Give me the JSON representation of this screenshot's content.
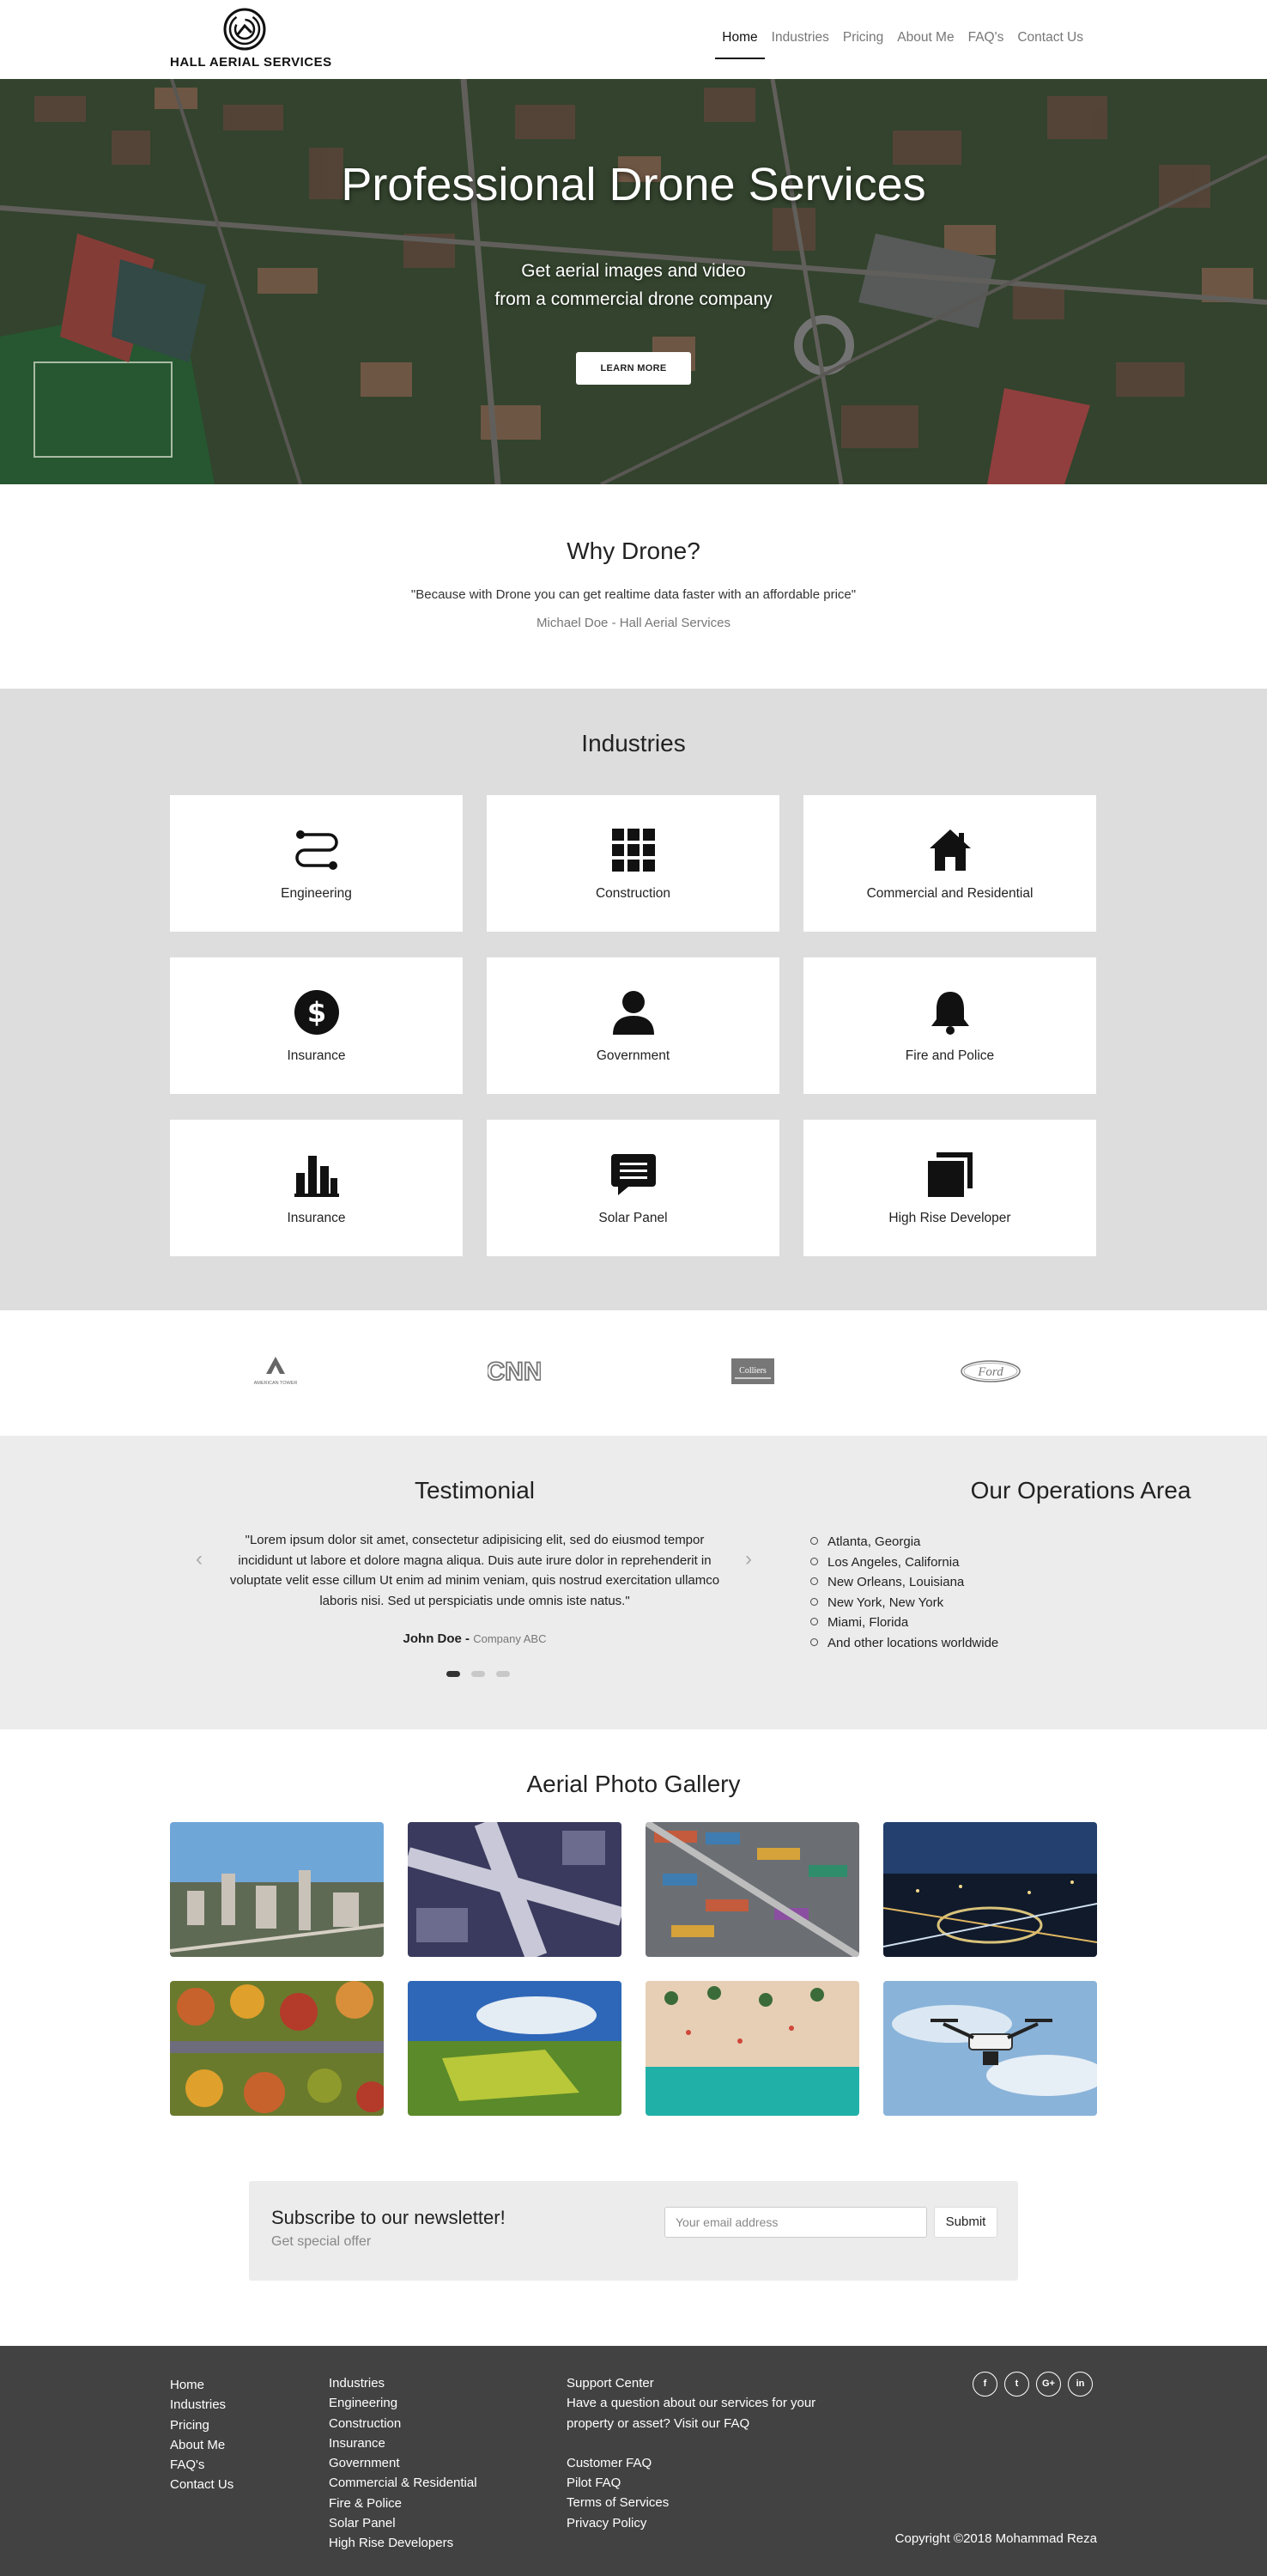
{
  "brand": {
    "name": "HALL AERIAL SERVICES",
    "logo_icon": "spiral-drone-logo"
  },
  "nav": {
    "items": [
      {
        "label": "Home",
        "active": true
      },
      {
        "label": "Industries"
      },
      {
        "label": "Pricing"
      },
      {
        "label": "About Me"
      },
      {
        "label": "FAQ's"
      },
      {
        "label": "Contact Us"
      }
    ]
  },
  "hero": {
    "title": "Professional Drone Services",
    "line1": "Get aerial images and video",
    "line2": "from a commercial drone company",
    "button": "LEARN MORE"
  },
  "why": {
    "title": "Why Drone?",
    "quote": "\"Because with Drone you can get realtime data faster with an affordable price\"",
    "author": "Michael Doe - Hall Aerial Services"
  },
  "industries": {
    "title": "Industries",
    "items": [
      {
        "label": "Engineering",
        "icon": "route-icon"
      },
      {
        "label": "Construction",
        "icon": "grid-icon"
      },
      {
        "label": "Commercial and Residential",
        "icon": "house-icon"
      },
      {
        "label": "Insurance",
        "icon": "dollar-icon"
      },
      {
        "label": "Government",
        "icon": "person-icon"
      },
      {
        "label": "Fire and Police",
        "icon": "bell-icon"
      },
      {
        "label": "Insurance",
        "icon": "bar-chart-icon"
      },
      {
        "label": "Solar Panel",
        "icon": "chat-icon"
      },
      {
        "label": "High Rise Developer",
        "icon": "stack-icon"
      }
    ]
  },
  "clients": {
    "logos": [
      {
        "name": "american-tower-logo",
        "text": "AMERICAN TOWER"
      },
      {
        "name": "cnn-logo",
        "text": "CNN"
      },
      {
        "name": "colliers-logo",
        "text": "Colliers"
      },
      {
        "name": "ford-logo",
        "text": "Ford"
      }
    ]
  },
  "testimonial": {
    "title": "Testimonial",
    "quote": "\"Lorem ipsum dolor sit amet, consectetur adipisicing elit, sed do eiusmod tempor incididunt ut labore et dolore magna aliqua. Duis aute irure dolor in reprehenderit in voluptate velit esse cillum Ut enim ad minim veniam, quis nostrud exercitation ullamco laboris nisi. Sed ut perspiciatis unde omnis iste natus.\"",
    "name": "John Doe -",
    "company": "Company ABC",
    "prev": "‹",
    "next": "›"
  },
  "operations": {
    "title": "Our Operations Area",
    "areas": [
      "Atlanta, Georgia",
      "Los Angeles, California",
      "New Orleans, Louisiana",
      "New York, New York",
      "Miami, Florida",
      "And other locations worldwide"
    ]
  },
  "gallery": {
    "title": "Aerial Photo Gallery"
  },
  "newsletter": {
    "title": "Subscribe to our newsletter!",
    "subtitle": "Get special offer",
    "placeholder": "Your email address",
    "button": "Submit"
  },
  "footer": {
    "links": [
      "Home",
      "Industries",
      "Pricing",
      "About Me",
      "FAQ's",
      "Contact Us"
    ],
    "industries_title": "Industries",
    "industries": [
      "Engineering",
      "Construction",
      "Insurance",
      "Government",
      "Commercial & Residential",
      "Fire & Police",
      "Solar Panel",
      "High Rise Developers"
    ],
    "support_title": "Support Center",
    "support_text1": "Have a question about our services for your",
    "support_text2": "property or asset? Visit our FAQ",
    "support_links": [
      "Customer FAQ",
      "Pilot FAQ",
      "Terms of Services",
      "Privacy Policy"
    ],
    "social": [
      {
        "icon": "facebook-icon",
        "glyph": "f"
      },
      {
        "icon": "twitter-icon",
        "glyph": "t"
      },
      {
        "icon": "google-plus-icon",
        "glyph": "G+"
      },
      {
        "icon": "linkedin-icon",
        "glyph": "in"
      }
    ],
    "copyright": "Copyright ©2018 Mohammad Reza"
  }
}
